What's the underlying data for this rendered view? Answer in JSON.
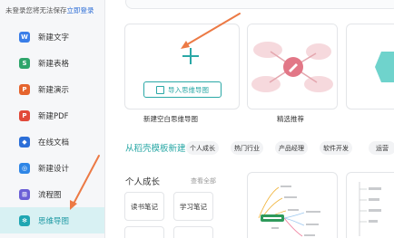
{
  "sidebar": {
    "login_prompt": "未登录您将无法保存",
    "login_link": "立即登录",
    "items": [
      {
        "label": "新建文字",
        "icon": "word-doc-icon",
        "glyph": "W",
        "color": "#3a7ee8"
      },
      {
        "label": "新建表格",
        "icon": "spreadsheet-icon",
        "glyph": "S",
        "color": "#2ea56b"
      },
      {
        "label": "新建演示",
        "icon": "presentation-icon",
        "glyph": "P",
        "color": "#e5642e"
      },
      {
        "label": "新建PDF",
        "icon": "pdf-icon",
        "glyph": "P",
        "color": "#e1493a"
      },
      {
        "label": "在线文档",
        "icon": "online-doc-icon",
        "glyph": "◆",
        "color": "#2c6fd8"
      },
      {
        "label": "新建设计",
        "icon": "design-icon",
        "glyph": "◎",
        "color": "#2f86e6"
      },
      {
        "label": "流程图",
        "icon": "flowchart-icon",
        "glyph": "⊞",
        "color": "#6b5fd6"
      },
      {
        "label": "思维导图",
        "icon": "mindmap-icon",
        "glyph": "✻",
        "color": "#1fa6b2",
        "active": true
      }
    ]
  },
  "main": {
    "new_blank_label": "新建空白思维导图",
    "import_button": "导入思维导图",
    "featured_label": "精选推荐",
    "template_section_title": "从稻壳模板新建",
    "tags": [
      "个人成长",
      "热门行业",
      "产品经理",
      "软件开发",
      "运营"
    ],
    "personal_growth_title": "个人成长",
    "see_all": "查看全部",
    "small_cards": [
      "读书笔记",
      "学习笔记"
    ]
  },
  "colors": {
    "accent": "#2aa8a6",
    "arrow": "#ec7a45",
    "active_bg": "#d8f1f3"
  }
}
